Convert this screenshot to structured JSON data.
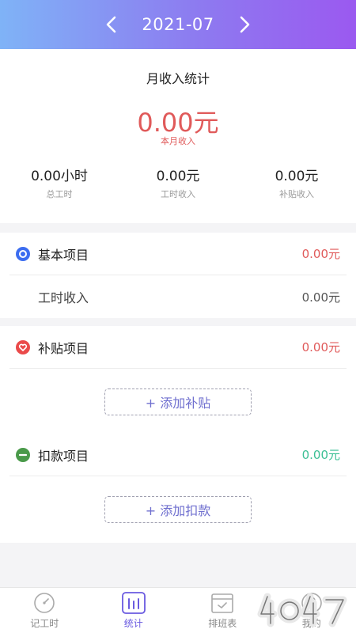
{
  "header": {
    "month": "2021-07"
  },
  "summary": {
    "title": "月收入统计",
    "total_value": "0.00元",
    "total_label": "本月收入",
    "stats": [
      {
        "value": "0.00小时",
        "label": "总工时"
      },
      {
        "value": "0.00元",
        "label": "工时收入"
      },
      {
        "value": "0.00元",
        "label": "补贴收入"
      }
    ]
  },
  "basic": {
    "title": "基本项目",
    "amount": "0.00元",
    "sub_label": "工时收入",
    "sub_amount": "0.00元"
  },
  "allowance": {
    "title": "补贴项目",
    "amount": "0.00元",
    "add_label": "+ 添加补贴"
  },
  "deduction": {
    "title": "扣款项目",
    "amount": "0.00元",
    "add_label": "+ 添加扣款"
  },
  "tabs": [
    {
      "label": "记工时"
    },
    {
      "label": "统计"
    },
    {
      "label": "排班表"
    },
    {
      "label": "我的"
    }
  ],
  "colors": {
    "income_red": "#e05a5a",
    "deduction_green": "#3bbf94",
    "basic_blue": "#3c6df0",
    "allowance_red": "#ea4a4a",
    "deduction_icon_green": "#4a9a4a",
    "accent_purple": "#6a5ae0"
  }
}
